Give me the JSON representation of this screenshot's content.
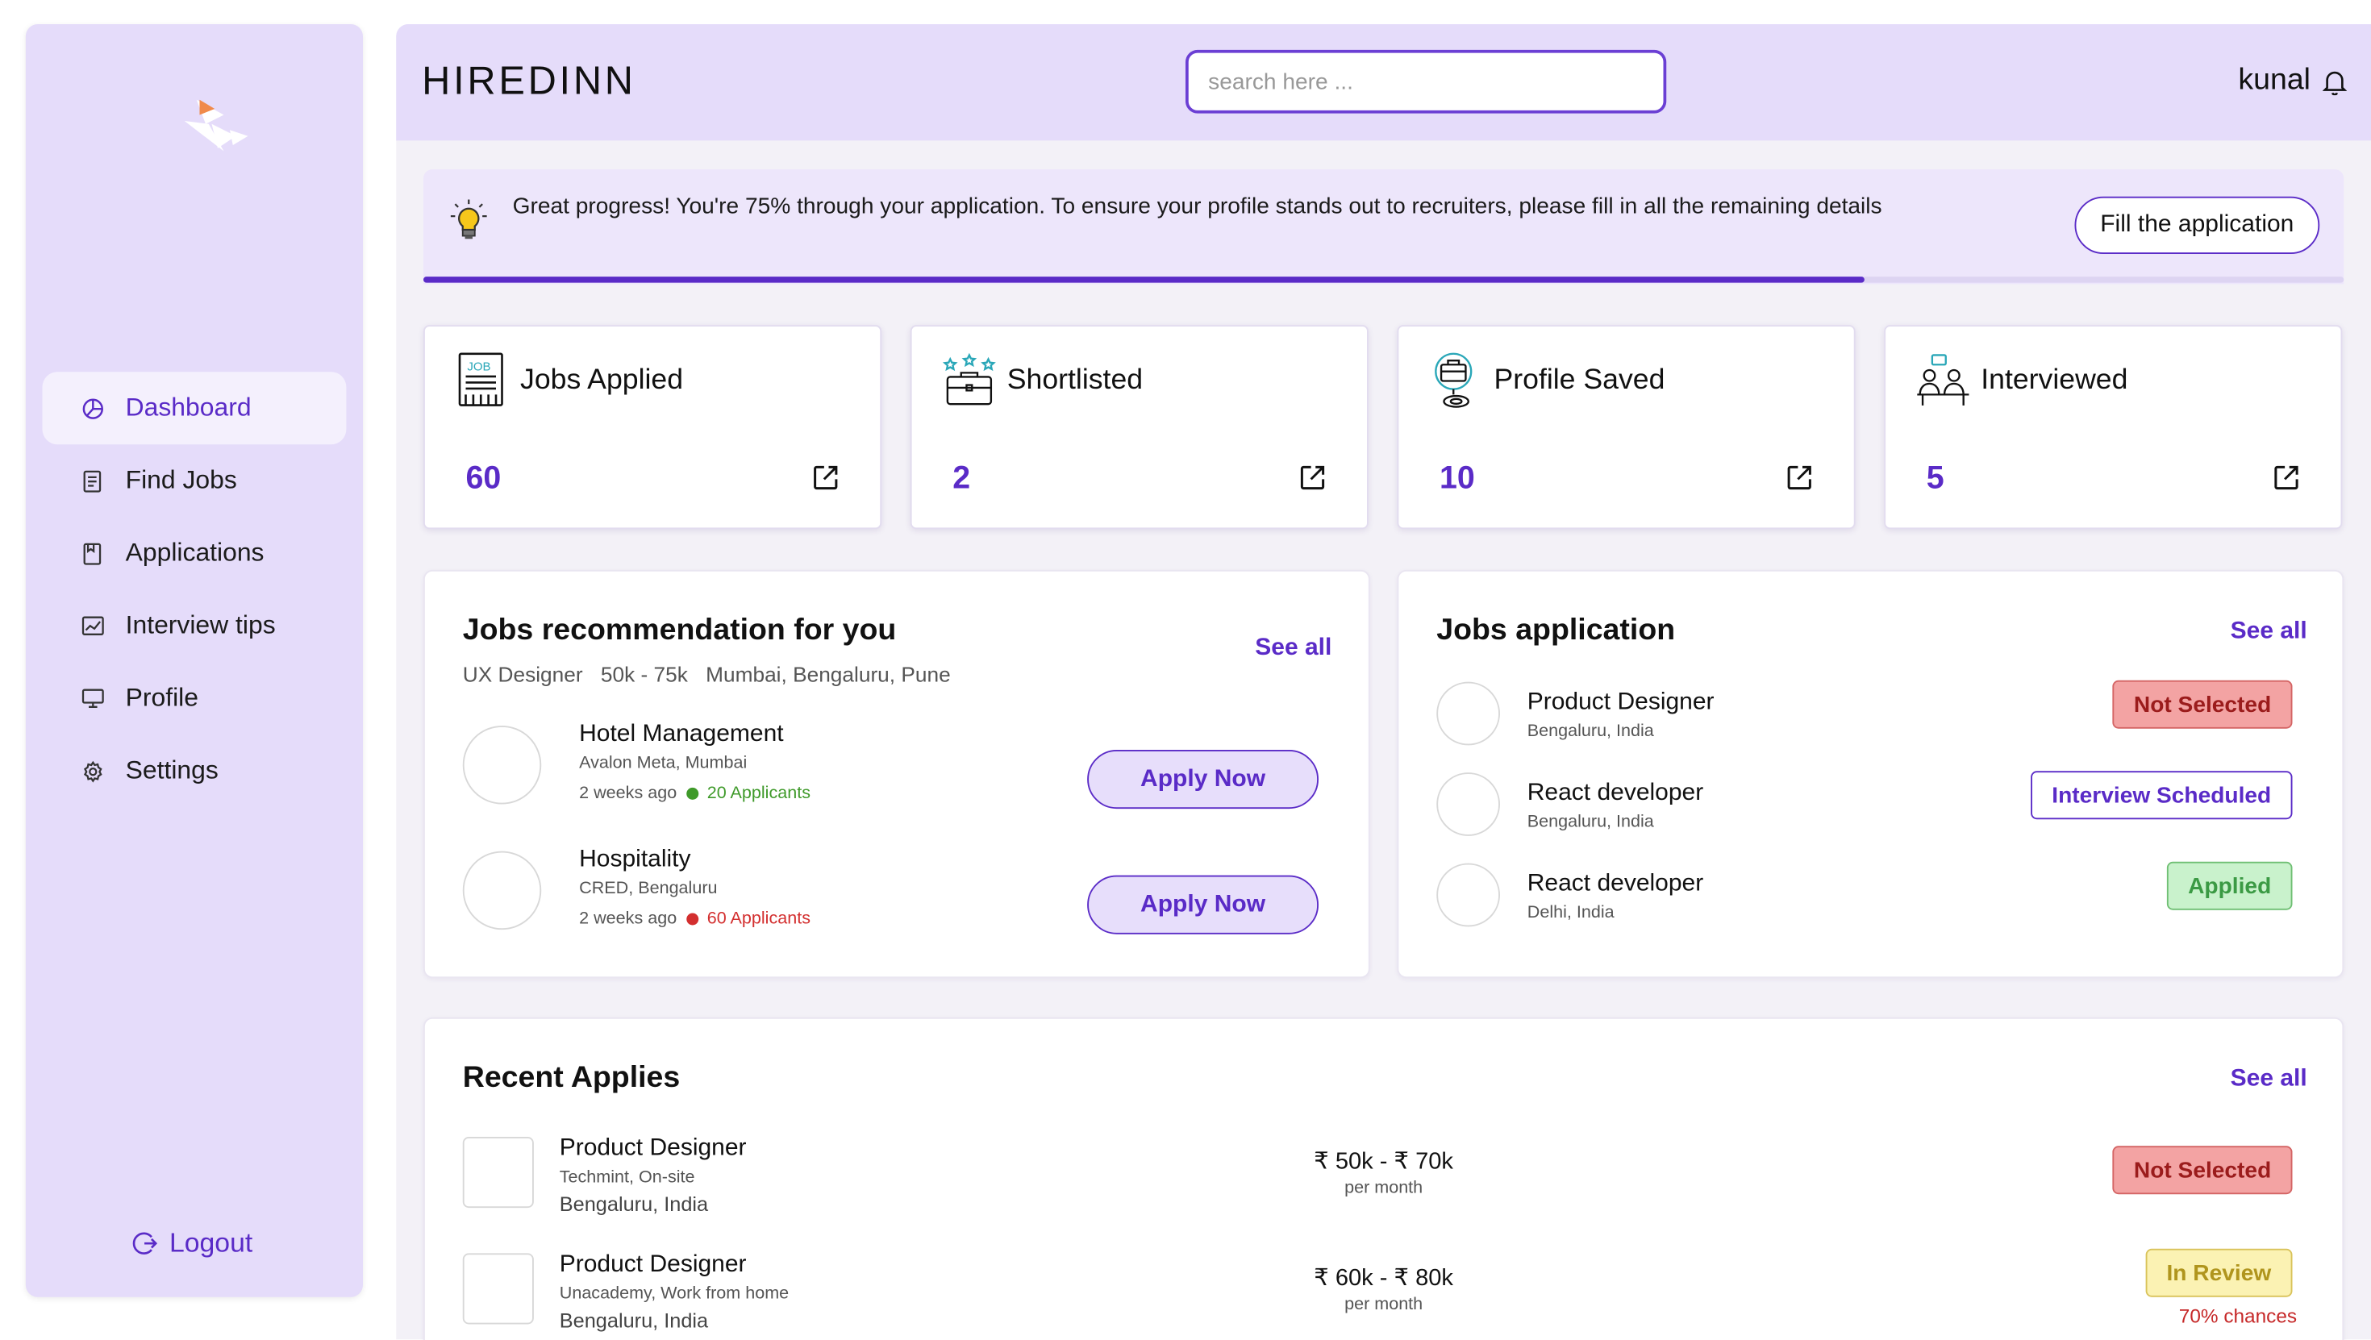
{
  "app": {
    "brand": "HIREDINN",
    "user_name": "kunal"
  },
  "search": {
    "placeholder": "search here ..."
  },
  "sidebar": {
    "items": [
      {
        "label": "Dashboard",
        "icon": "pie-chart-icon",
        "active": true
      },
      {
        "label": "Find Jobs",
        "icon": "document-list-icon"
      },
      {
        "label": "Applications",
        "icon": "bookmark-page-icon"
      },
      {
        "label": "Interview tips",
        "icon": "trend-chart-icon"
      },
      {
        "label": "Profile",
        "icon": "monitor-icon"
      },
      {
        "label": "Settings",
        "icon": "gear-icon"
      }
    ],
    "logout_label": "Logout"
  },
  "banner": {
    "message": "Great progress! You're 75% through your application. To ensure your profile stands out to recruiters, please fill in all the remaining details",
    "button_label": "Fill the application",
    "progress_percent": 75
  },
  "stats": [
    {
      "label": "Jobs Applied",
      "value": "60",
      "icon": "job-board-icon"
    },
    {
      "label": "Shortlisted",
      "value": "2",
      "icon": "briefcase-stars-icon"
    },
    {
      "label": "Profile Saved",
      "value": "10",
      "icon": "briefcase-pin-icon"
    },
    {
      "label": "Interviewed",
      "value": "5",
      "icon": "interview-desk-icon"
    }
  ],
  "recommendations": {
    "title": "Jobs recommendation for you",
    "see_all": "See all",
    "filters": [
      "UX Designer",
      "50k - 75k",
      "Mumbai, Bengaluru, Pune"
    ],
    "jobs": [
      {
        "title": "Hotel Management",
        "company": "Avalon Meta, Mumbai",
        "posted": "2 weeks ago",
        "applicants": "20 Applicants",
        "applicants_color": "#3f9a2a",
        "button": "Apply Now"
      },
      {
        "title": "Hospitality",
        "company": "CRED, Bengaluru",
        "posted": "2 weeks ago",
        "applicants": "60 Applicants",
        "applicants_color": "#d32f2f",
        "button": "Apply Now"
      }
    ]
  },
  "applications": {
    "title": "Jobs application",
    "see_all": "See all",
    "items": [
      {
        "title": "Product Designer",
        "location": "Bengaluru, India",
        "status": "Not Selected",
        "status_style": "red"
      },
      {
        "title": "React developer",
        "location": "Bengaluru, India",
        "status": "Interview Scheduled",
        "status_style": "purple"
      },
      {
        "title": "React developer",
        "location": "Delhi, India",
        "status": "Applied",
        "status_style": "green"
      }
    ]
  },
  "recent": {
    "title": "Recent Applies",
    "see_all": "See all",
    "items": [
      {
        "title": "Product Designer",
        "company": "Techmint, On-site",
        "location": "Bengaluru, India",
        "salary": "₹ 50k - ₹ 70k",
        "period": "per month",
        "status": "Not Selected",
        "status_style": "red",
        "note": ""
      },
      {
        "title": "Product Designer",
        "company": "Unacademy, Work from home",
        "location": "Bengaluru, India",
        "salary": "₹ 60k - ₹ 80k",
        "period": "per month",
        "status": "In Review",
        "status_style": "yellow",
        "note": "70% chances"
      }
    ]
  },
  "colors": {
    "accent": "#5a2bc7",
    "sidebar_bg": "#e5dcfa",
    "banner_bg": "#ede6fb"
  }
}
